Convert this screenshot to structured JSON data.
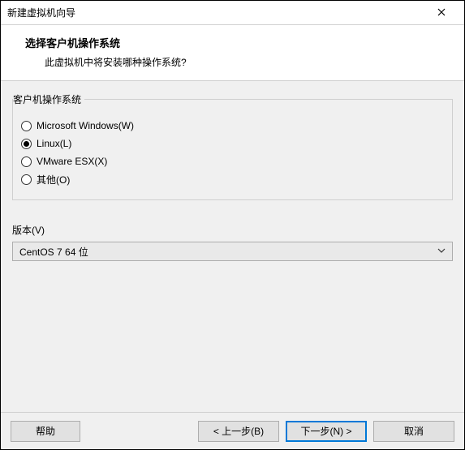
{
  "window": {
    "title": "新建虚拟机向导"
  },
  "header": {
    "title": "选择客户机操作系统",
    "subtitle": "此虚拟机中将安装哪种操作系统?"
  },
  "group": {
    "legend": "客户机操作系统",
    "options": [
      {
        "label": "Microsoft Windows(W)",
        "checked": false
      },
      {
        "label": "Linux(L)",
        "checked": true
      },
      {
        "label": "VMware ESX(X)",
        "checked": false
      },
      {
        "label": "其他(O)",
        "checked": false
      }
    ]
  },
  "version": {
    "label": "版本(V)",
    "selected": "CentOS 7 64 位"
  },
  "footer": {
    "help": "帮助",
    "back": "< 上一步(B)",
    "next": "下一步(N) >",
    "cancel": "取消"
  }
}
